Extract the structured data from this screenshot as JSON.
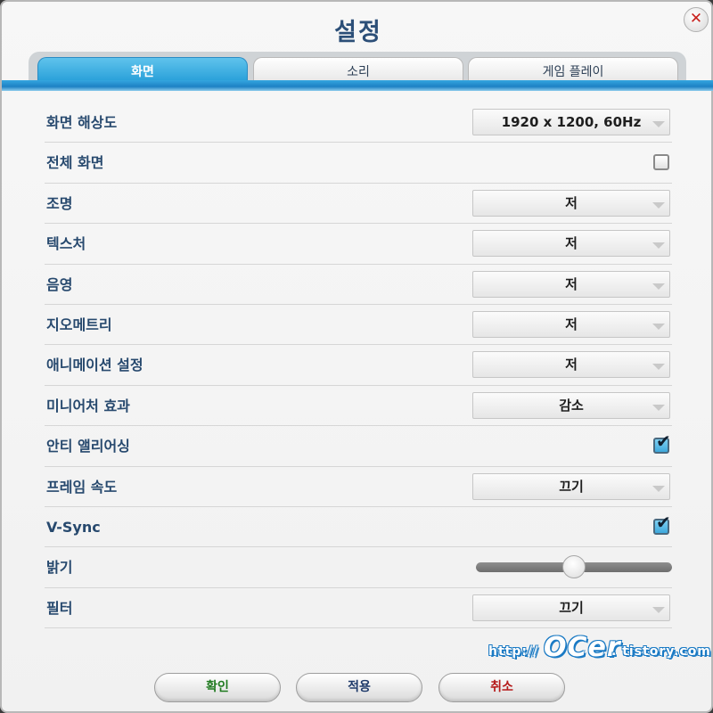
{
  "dialog": {
    "title": "설정",
    "close_label": "✕"
  },
  "tabs": [
    {
      "label": "화면",
      "active": true
    },
    {
      "label": "소리",
      "active": false
    },
    {
      "label": "게임 플레이",
      "active": false
    }
  ],
  "settings": {
    "resolution": {
      "label": "화면 해상도",
      "value": "1920 x 1200, 60Hz"
    },
    "fullscreen": {
      "label": "전체 화면",
      "checked": false
    },
    "lighting": {
      "label": "조명",
      "value": "저"
    },
    "texture": {
      "label": "텍스처",
      "value": "저"
    },
    "shadow": {
      "label": "음영",
      "value": "저"
    },
    "geometry": {
      "label": "지오메트리",
      "value": "저"
    },
    "animation": {
      "label": "애니메이션 설정",
      "value": "저"
    },
    "miniature": {
      "label": "미니어처 효과",
      "value": "감소"
    },
    "antialiasing": {
      "label": "안티 앨리어싱",
      "checked": true,
      "checkmark": "✔"
    },
    "framerate": {
      "label": "프레임 속도",
      "value": "끄기"
    },
    "vsync": {
      "label": "V-Sync",
      "checked": true,
      "checkmark": "✔"
    },
    "brightness": {
      "label": "밝기",
      "level_fraction": 0.5
    },
    "filter": {
      "label": "필터",
      "value": "끄기"
    }
  },
  "watermark": {
    "prefix": "http://",
    "name": "OCer",
    "suffix": ". tistory.com"
  },
  "buttons": {
    "confirm": {
      "label": "확인",
      "color": "#1f7a1f"
    },
    "apply": {
      "label": "적용",
      "color": "#1e3a6a"
    },
    "cancel": {
      "label": "취소",
      "color": "#b51a1a"
    }
  },
  "colors": {
    "accent": "#1f9ad6",
    "label_text": "#27496e"
  }
}
